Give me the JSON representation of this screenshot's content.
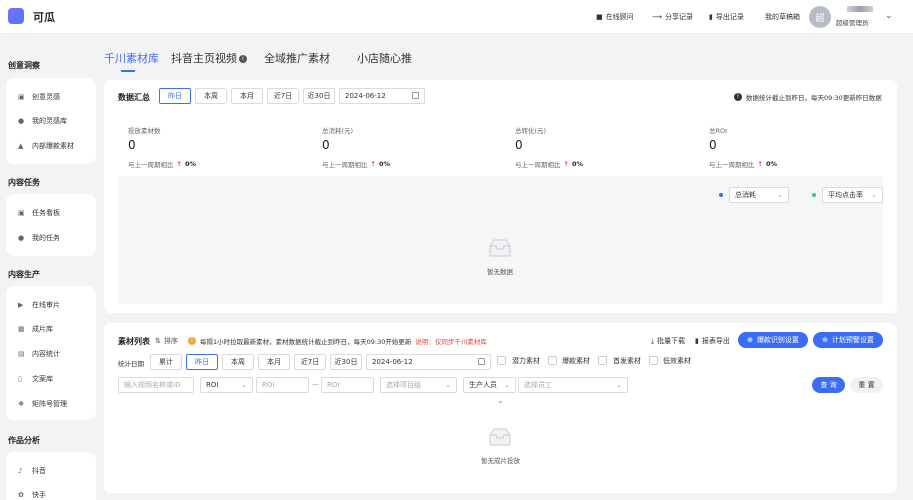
{
  "app": {
    "title": "可瓜"
  },
  "topnav": {
    "consult": "在线顾问",
    "share": "分享记录",
    "export": "导出记录",
    "drafts": "我的草稿箱",
    "avatar_letter": "超",
    "user_role": "超级管理员"
  },
  "sidebar": {
    "groups": [
      {
        "title": "创意洞察",
        "items": [
          {
            "label": "创意灵感",
            "icon": "bulb-icon"
          },
          {
            "label": "我的灵感库",
            "icon": "user-icon"
          },
          {
            "label": "内部爆款素材",
            "icon": "fire-icon"
          }
        ]
      },
      {
        "title": "内容任务",
        "items": [
          {
            "label": "任务看板",
            "icon": "board-icon"
          },
          {
            "label": "我的任务",
            "icon": "user-icon"
          }
        ]
      },
      {
        "title": "内容生产",
        "items": [
          {
            "label": "在线审片",
            "icon": "review-icon"
          },
          {
            "label": "成片库",
            "icon": "film-icon"
          },
          {
            "label": "内容统计",
            "icon": "stats-icon"
          },
          {
            "label": "文案库",
            "icon": "doc-icon"
          },
          {
            "label": "矩阵号管理",
            "icon": "matrix-icon"
          }
        ]
      },
      {
        "title": "作品分析",
        "items": [
          {
            "label": "抖音",
            "icon": "tiktok-icon"
          },
          {
            "label": "快手",
            "icon": "kuaishou-icon"
          }
        ]
      }
    ]
  },
  "tabs": [
    {
      "label": "千川素材库",
      "active": true
    },
    {
      "label": "抖音主页视频",
      "active": false
    },
    {
      "label": "全域推广素材",
      "active": false
    },
    {
      "label": "小店随心推",
      "active": false
    }
  ],
  "summary": {
    "title": "数据汇总",
    "ranges": [
      "昨日",
      "本周",
      "本月",
      "近7日",
      "近30日"
    ],
    "date": "2024-06-12",
    "notice": "数据统计截止到昨日，每天09:30更新昨日数据",
    "metrics": [
      {
        "label": "投放素材数",
        "value": "0",
        "cmp_label": "与上一周期相比",
        "cmp_value": "0%"
      },
      {
        "label": "总消耗(元)",
        "value": "0",
        "cmp_label": "与上一周期相比",
        "cmp_value": "0%"
      },
      {
        "label": "总转化(元)",
        "value": "0",
        "cmp_label": "与上一周期相比",
        "cmp_value": "0%"
      },
      {
        "label": "总ROI",
        "value": "0",
        "cmp_label": "与上一周期相比",
        "cmp_value": "0%"
      }
    ],
    "legend": [
      {
        "label": "总消耗",
        "color": "#3b6ef5"
      },
      {
        "label": "平均点击率",
        "color": "#36c48e"
      }
    ],
    "empty_text": "暂无数据"
  },
  "list": {
    "title": "素材列表",
    "sort_label": "排序",
    "notice": "每隔1小时拉取最新素材，素材数据统计截止到昨日，每天09:30开始更新",
    "notice_link": "说明：仅同步千川素材库",
    "batch_download": "批量下载",
    "export_report": "报表导出",
    "btn_viral": "爆款识别设置",
    "btn_plan": "计划预警设置",
    "stat_label": "统计日期",
    "ranges": [
      "累计",
      "昨日",
      "本周",
      "本月",
      "近7日",
      "近30日"
    ],
    "date": "2024-06-12",
    "checkboxes": [
      "潜力素材",
      "爆款素材",
      "首发素材",
      "低效素材"
    ],
    "filters": {
      "name_placeholder": "输入视频名称或ID",
      "metric": "ROI",
      "min_placeholder": "ROI",
      "range_sep": "—",
      "max_placeholder": "ROI",
      "project_placeholder": "选择项目组",
      "producer": "生产人员",
      "staff_placeholder": "选择员工"
    },
    "query": "查 询",
    "reset": "重 置",
    "empty_text": "暂无成片投放"
  }
}
